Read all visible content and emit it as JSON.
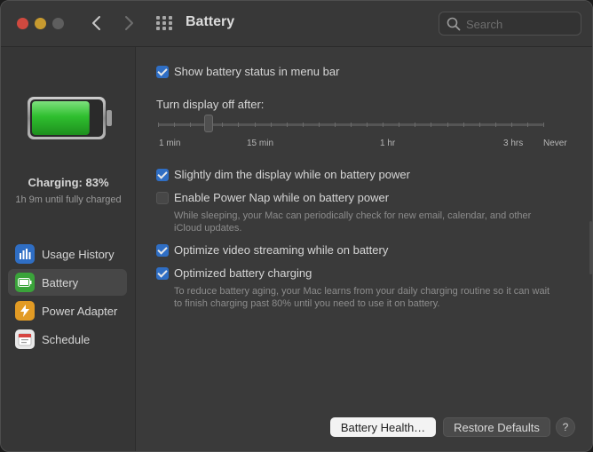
{
  "window": {
    "title": "Battery"
  },
  "search": {
    "placeholder": "Search"
  },
  "status": {
    "charge_label": "Charging: 83%",
    "charge_level": 83,
    "time_remaining": "1h 9m until fully charged"
  },
  "sidebar": {
    "items": [
      {
        "label": "Usage History",
        "icon": "bar-chart-icon",
        "color": "#2f6ec4"
      },
      {
        "label": "Battery",
        "icon": "battery-icon",
        "color": "#3aa33a"
      },
      {
        "label": "Power Adapter",
        "icon": "lightning-icon",
        "color": "#e29b24"
      },
      {
        "label": "Schedule",
        "icon": "calendar-icon",
        "color": "#e8e8e8"
      }
    ],
    "selected": "Battery"
  },
  "options": {
    "show_status": {
      "label": "Show battery status in menu bar",
      "checked": true
    },
    "dim_display": {
      "label": "Slightly dim the display while on battery power",
      "checked": true
    },
    "power_nap": {
      "label": "Enable Power Nap while on battery power",
      "checked": false,
      "desc_line1": "While sleeping, your Mac can periodically check for new email, calendar, and other",
      "desc_line2": "iCloud updates."
    },
    "video_streaming": {
      "label": "Optimize video streaming while on battery",
      "checked": true
    },
    "battery_charging": {
      "label": "Optimized battery charging",
      "checked": true,
      "desc_line1": "To reduce battery aging, your Mac learns from your daily charging routine so it can wait",
      "desc_line2": "to finish charging past 80% until you need to use it on battery."
    }
  },
  "display_off": {
    "title": "Turn display off after:",
    "ticks": [
      "1 min",
      "15 min",
      "1 hr",
      "3 hrs",
      "Never"
    ],
    "value": "2 min"
  },
  "buttons": {
    "battery_health": "Battery Health…",
    "restore_defaults": "Restore Defaults",
    "help": "?"
  },
  "colors": {
    "accent": "#2f6ec4",
    "battery_fill": "#2fbf2f"
  }
}
